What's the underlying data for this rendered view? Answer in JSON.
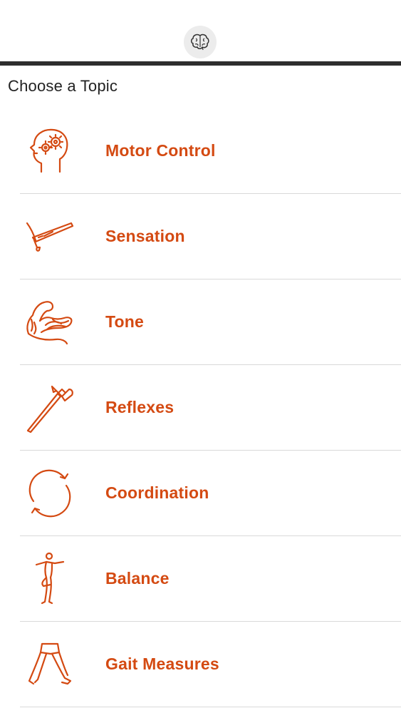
{
  "header": {
    "logo_icon": "brain-icon"
  },
  "page": {
    "section_title": "Choose a Topic"
  },
  "accent_color": "#d44a12",
  "topics": [
    {
      "label": "Motor Control",
      "icon": "head-gears-icon"
    },
    {
      "label": "Sensation",
      "icon": "sensory-tool-icon"
    },
    {
      "label": "Tone",
      "icon": "flexed-arm-icon"
    },
    {
      "label": "Reflexes",
      "icon": "reflex-hammer-icon"
    },
    {
      "label": "Coordination",
      "icon": "circular-arrows-icon"
    },
    {
      "label": "Balance",
      "icon": "one-leg-stand-icon"
    },
    {
      "label": "Gait Measures",
      "icon": "walking-legs-icon"
    }
  ]
}
